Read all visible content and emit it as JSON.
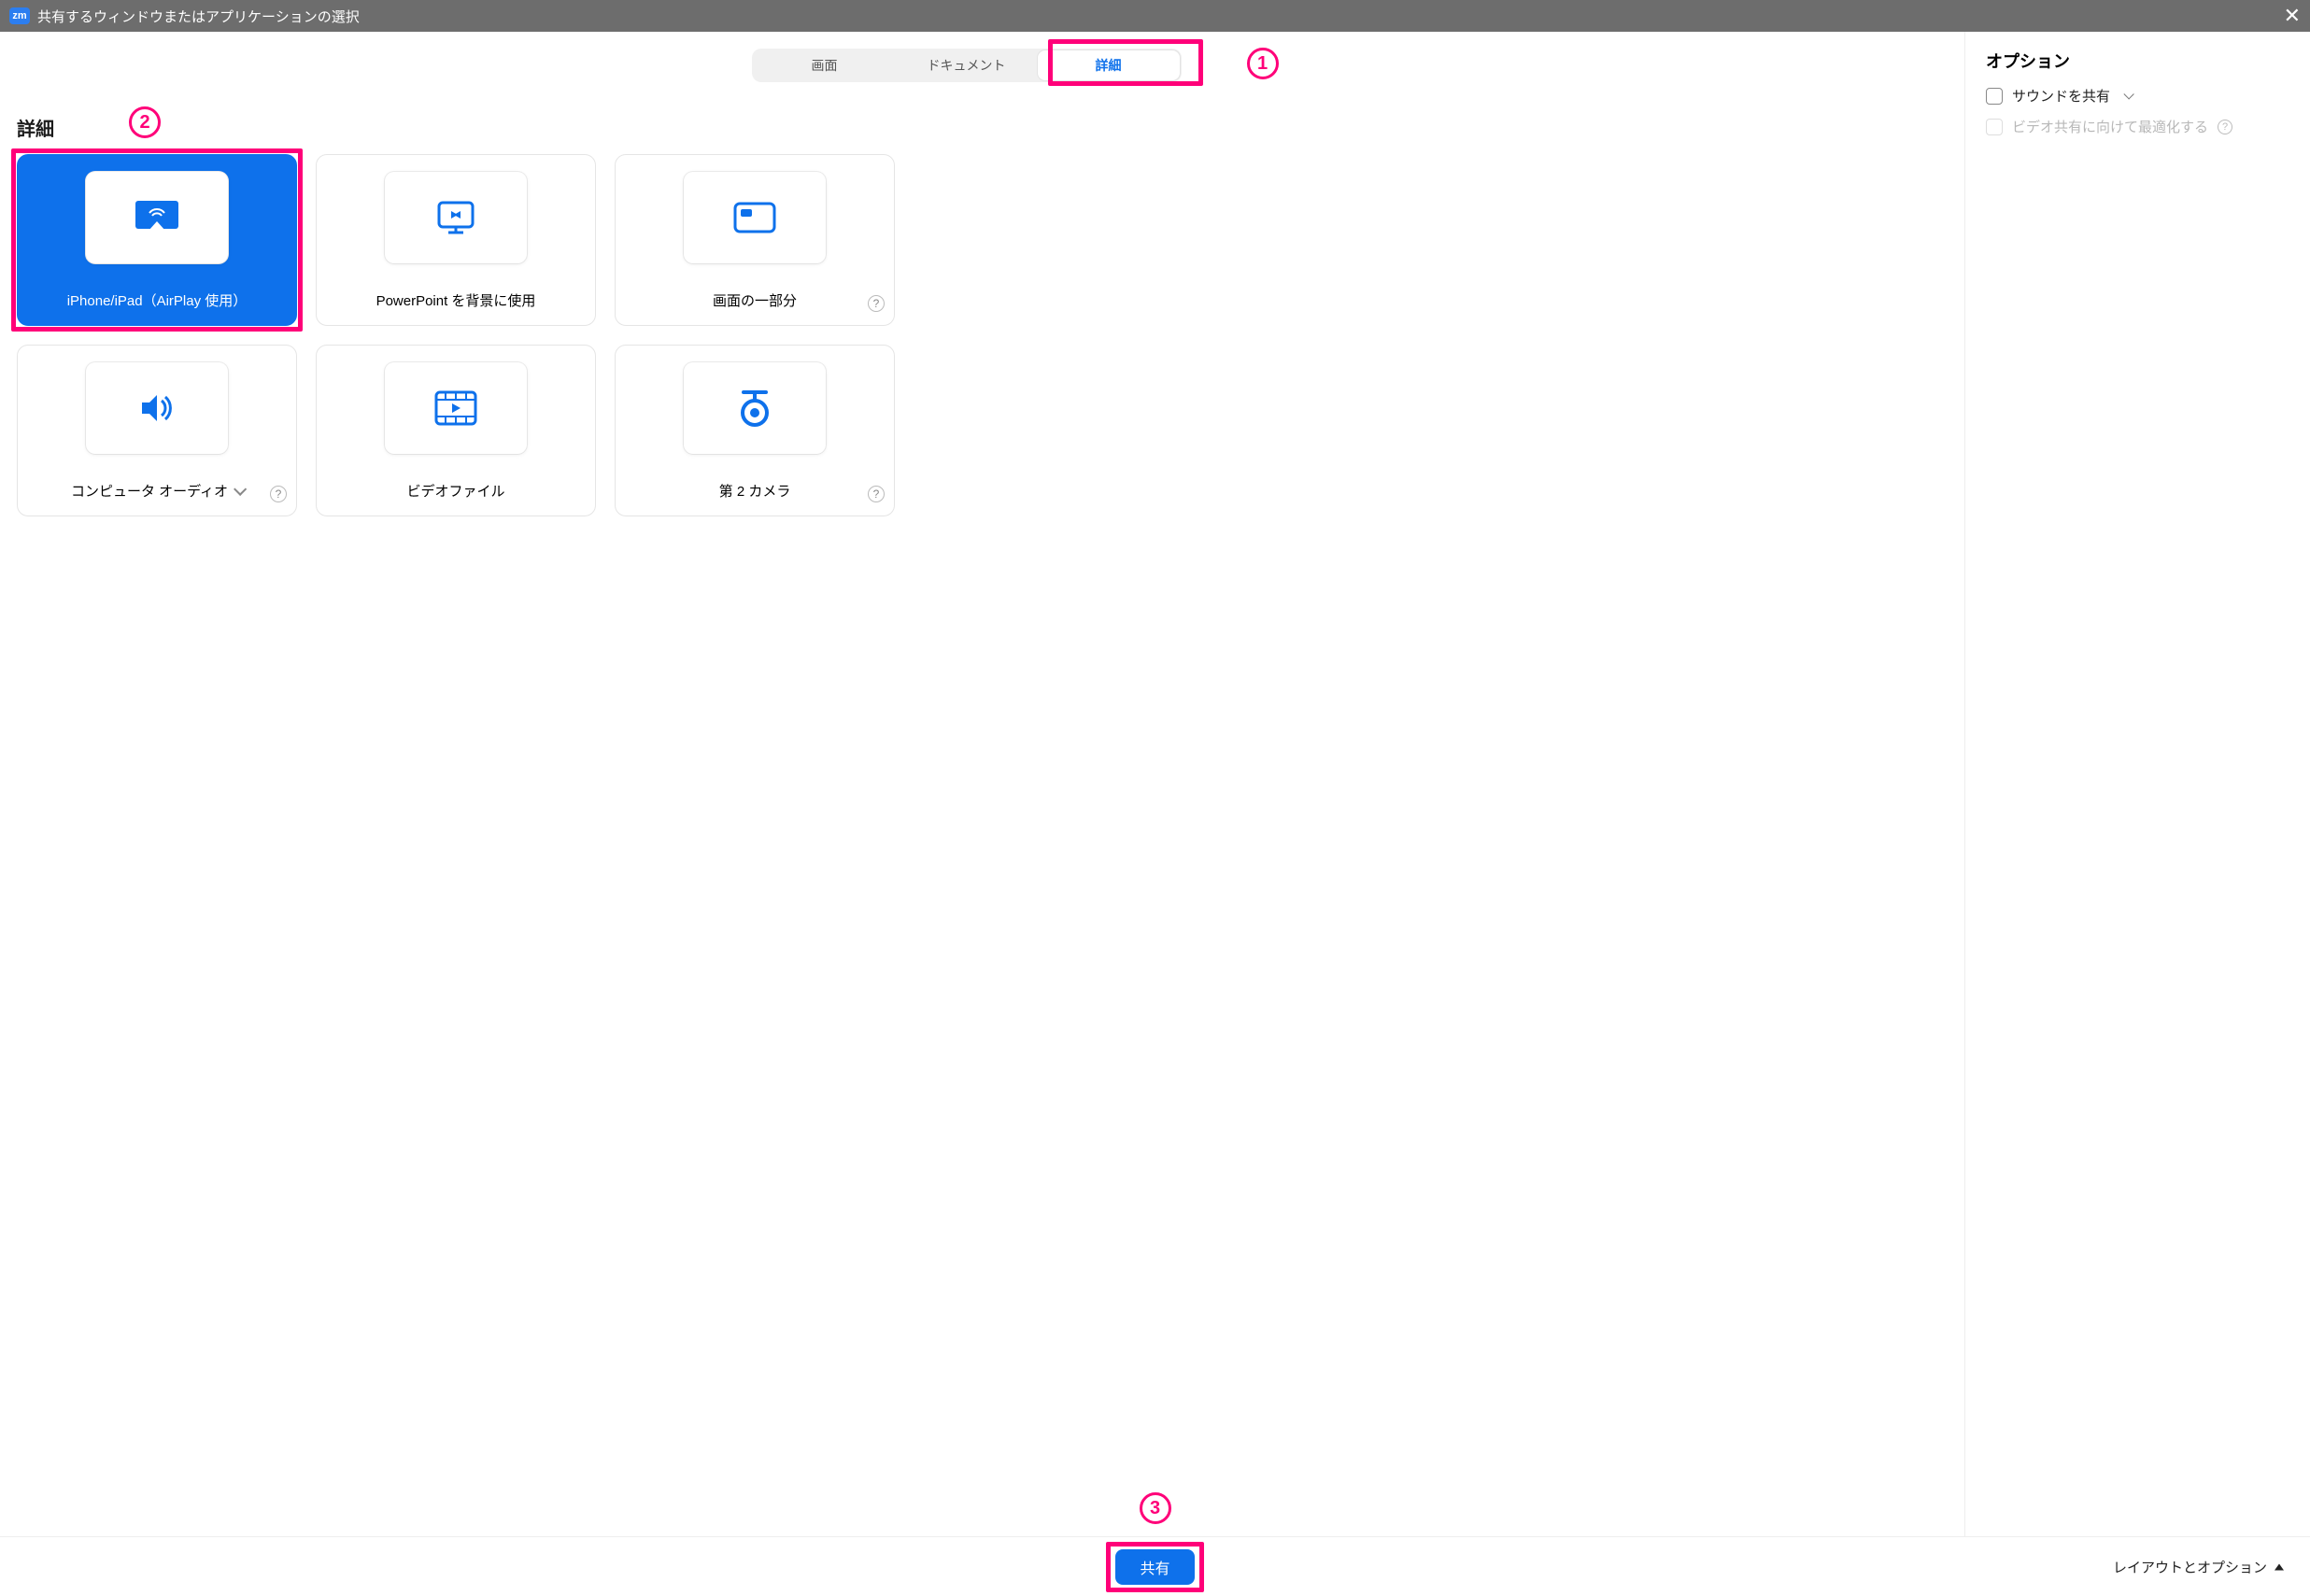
{
  "titlebar": {
    "app_icon_text": "zm",
    "title": "共有するウィンドウまたはアプリケーションの選択"
  },
  "tabs": {
    "items": [
      {
        "label": "画面",
        "active": false
      },
      {
        "label": "ドキュメント",
        "active": false
      },
      {
        "label": "詳細",
        "active": true
      }
    ]
  },
  "annotations": {
    "a1": "1",
    "a2": "2",
    "a3": "3"
  },
  "section": {
    "heading": "詳細"
  },
  "cards": {
    "c0": {
      "label": "iPhone/iPad（AirPlay 使用）"
    },
    "c1": {
      "label": "PowerPoint を背景に使用"
    },
    "c2": {
      "label": "画面の一部分"
    },
    "c3": {
      "label": "コンピュータ オーディオ"
    },
    "c4": {
      "label": "ビデオファイル"
    },
    "c5": {
      "label": "第 2 カメラ"
    }
  },
  "options": {
    "heading": "オプション",
    "share_sound": "サウンドを共有",
    "optimize_video": "ビデオ共有に向けて最適化する"
  },
  "footer": {
    "share": "共有",
    "layout_options": "レイアウトとオプション"
  }
}
